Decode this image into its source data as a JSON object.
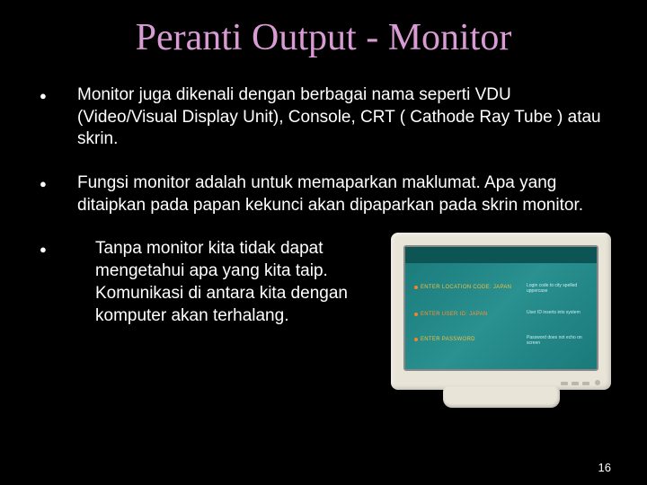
{
  "title": "Peranti Output - Monitor",
  "bullets": [
    "Monitor juga dikenali dengan berbagai nama seperti VDU (Video/Visual Display Unit), Console, CRT ( Cathode Ray Tube ) atau skrin.",
    "Fungsi monitor adalah untuk memaparkan maklumat. Apa yang ditaipkan pada papan kekunci akan dipaparkan pada skrin monitor.",
    "Tanpa monitor kita tidak dapat mengetahui apa yang kita taip. Komunikasi di antara kita dengan komputer akan terhalang."
  ],
  "monitor": {
    "lines": [
      "ENTER LOCATION CODE: JAPAN",
      "ENTER USER ID: JAPAN",
      "ENTER PASSWORD"
    ],
    "rightNotes": [
      "Login code to city spelled uppercase",
      "User ID inserts into system",
      "Password does not echo on screen"
    ]
  },
  "pageNumber": "16"
}
